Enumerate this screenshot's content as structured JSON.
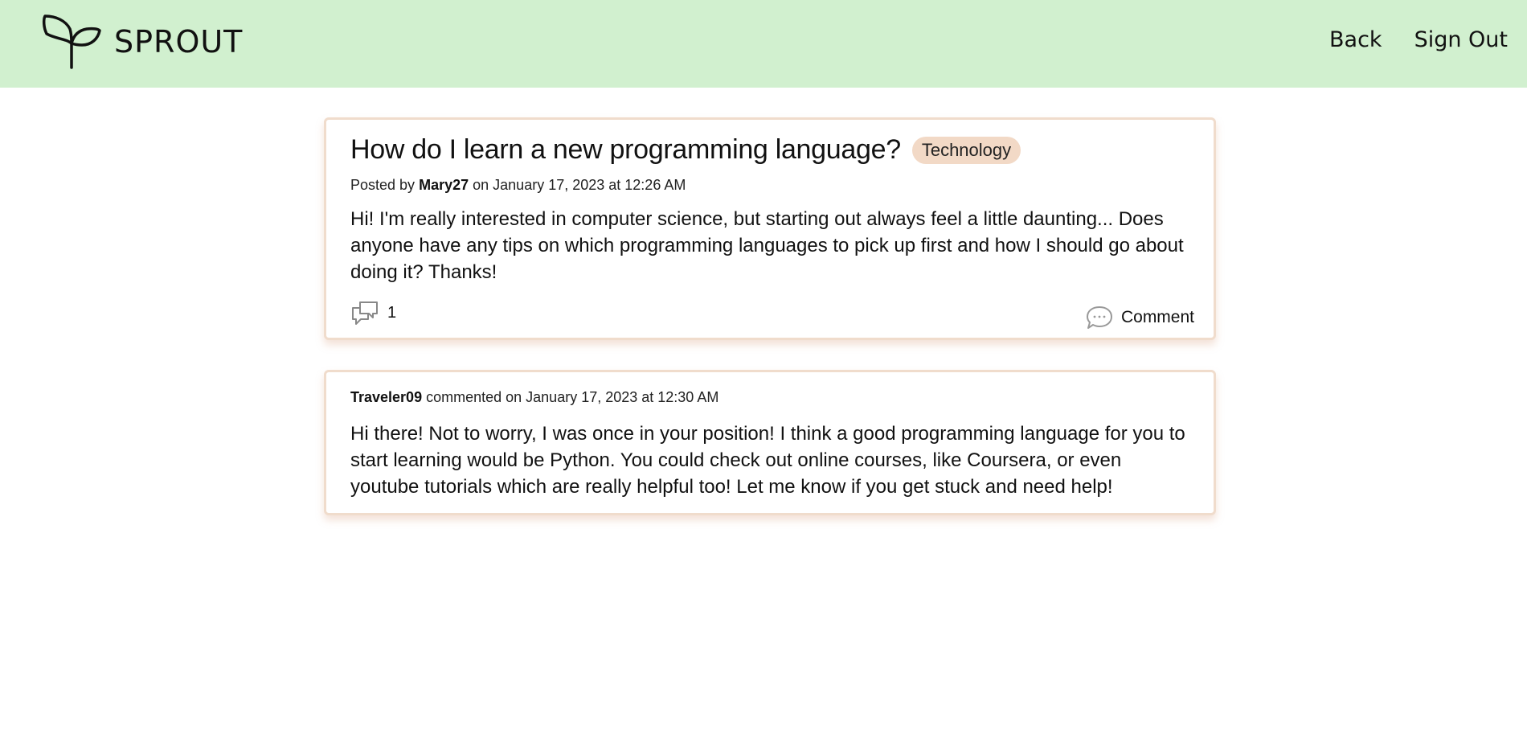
{
  "header": {
    "brand_name": "SPROUT",
    "nav": {
      "back_label": "Back",
      "signout_label": "Sign Out"
    }
  },
  "post": {
    "title": "How do I learn a new programming language?",
    "tag": "Technology",
    "meta_prefix": "Posted by",
    "author": "Mary27",
    "meta_suffix": "on January 17, 2023 at 12:26 AM",
    "body": "Hi! I'm really interested in computer science, but starting out always feel a little daunting... Does anyone have any tips on which programming languages to pick up first and how I should go about doing it? Thanks!",
    "comment_count": "1",
    "comment_button_label": "Comment"
  },
  "comments": [
    {
      "author": "Traveler09",
      "meta_suffix": "commented on January 17, 2023 at 12:30 AM",
      "body": "Hi there! Not to worry, I was once in your position! I think a good programming language for you to start learning would be Python. You could check out online courses, like Coursera, or even youtube tutorials which are really helpful too! Let me know if you get stuck and need help!"
    }
  ],
  "icons": {
    "logo": "sprout-icon",
    "comment_count": "speech-bubbles-icon",
    "comment_button": "chat-bubble-icon"
  },
  "colors": {
    "header_bg": "#d1f0cf",
    "card_border": "#f0dccc",
    "tag_bg": "#f2d9c6"
  }
}
